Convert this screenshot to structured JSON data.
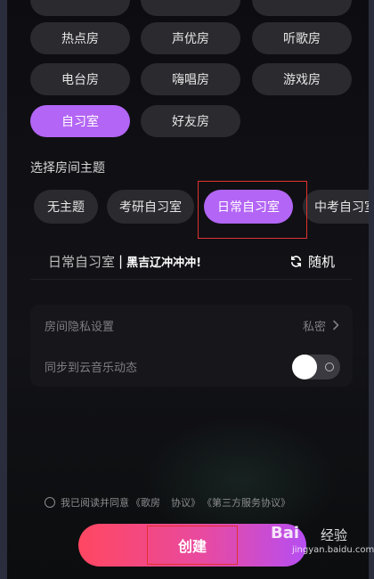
{
  "room_types": {
    "row0": [
      "",
      "",
      ""
    ],
    "row1": [
      "热点房",
      "声优房",
      "听歌房"
    ],
    "row2": [
      "电台房",
      "嗨唱房",
      "游戏房"
    ],
    "row3": [
      "自习室",
      "好友房"
    ],
    "selected": "自习室"
  },
  "theme": {
    "section_title": "选择房间主题",
    "options": [
      "无主题",
      "考研自习室",
      "日常自习室",
      "中考自习室"
    ],
    "selected": "日常自习室"
  },
  "room_name": {
    "prefix": "日常自习室",
    "separator": "|",
    "slogan": "黑吉辽冲冲冲!",
    "random_label": "随机"
  },
  "settings": {
    "privacy_label": "房间隐私设置",
    "privacy_value": "私密",
    "sync_label": "同步到云音乐动态",
    "sync_on": true
  },
  "agreement": {
    "prefix": "我已阅读并同意",
    "link1": "《歌房",
    "link1_tail": "协议》",
    "link2": "《第三方服务协议》"
  },
  "create_button": {
    "label": "创建"
  },
  "watermark": {
    "brand": "Bai",
    "cn": "经验",
    "url": "jingyan.baidu.com"
  },
  "colors": {
    "accent": "#b365f5",
    "highlight": "#e0322e",
    "create_start": "#ff4761",
    "create_end": "#b64ef2"
  }
}
